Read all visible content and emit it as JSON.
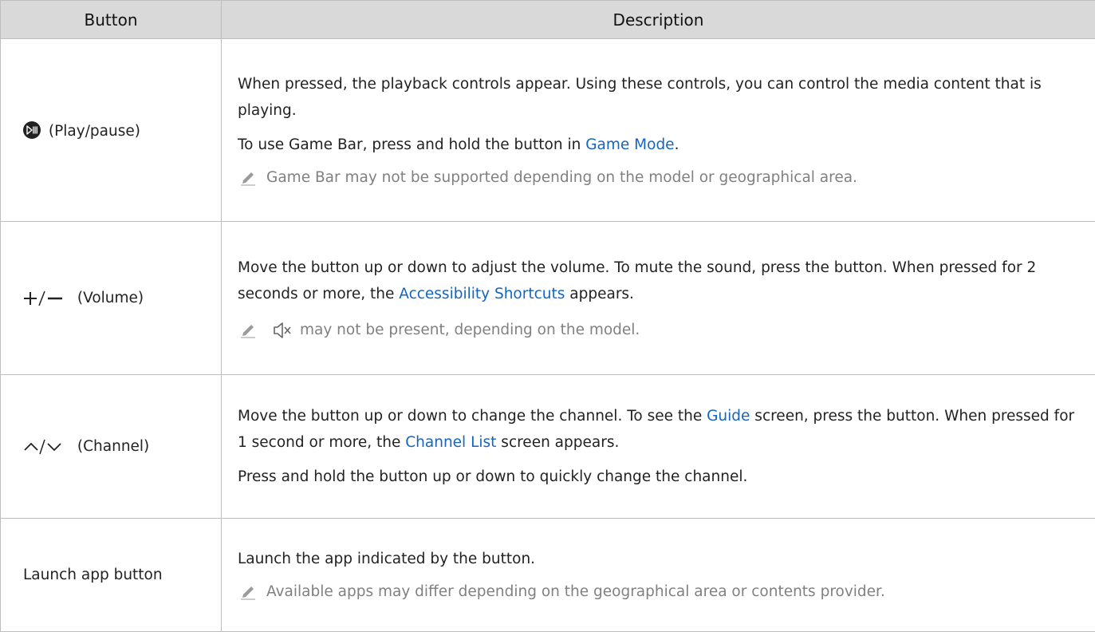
{
  "header": {
    "col_button": "Button",
    "col_description": "Description"
  },
  "rows": [
    {
      "button_label": "(Play/pause)",
      "icon": "play-pause-icon",
      "desc1": "When pressed, the playback controls appear. Using these controls, you can control the media content that is playing.",
      "desc2_pre": "To use Game Bar, press and hold the button in ",
      "desc2_link": "Game Mode",
      "desc2_post": ".",
      "note": "Game Bar may not be supported depending on the model or geographical area."
    },
    {
      "button_label": "(Volume)",
      "icon": "volume-plus-minus-icon",
      "desc1_pre": "Move the button up or down to adjust the volume. To mute the sound, press the button. When pressed for 2 seconds or more, the ",
      "desc1_link": "Accessibility Shortcuts",
      "desc1_post": " appears.",
      "note": "may not be present, depending on the model."
    },
    {
      "button_label": "(Channel)",
      "icon": "channel-up-down-icon",
      "desc1_pre": "Move the button up or down to change the channel. To see the ",
      "desc1_link1": "Guide",
      "desc1_mid": " screen, press the button. When pressed for 1 second or more, the ",
      "desc1_link2": "Channel List",
      "desc1_post": " screen appears.",
      "desc2": "Press and hold the button up or down to quickly change the channel."
    },
    {
      "button_label": "Launch app button",
      "desc1": "Launch the app indicated by the button.",
      "note": "Available apps may differ depending on the geographical area or contents provider."
    }
  ],
  "colors": {
    "header_bg": "#d9d9d9",
    "link": "#1565c0",
    "note": "#808080",
    "border": "#bdbdbd"
  }
}
